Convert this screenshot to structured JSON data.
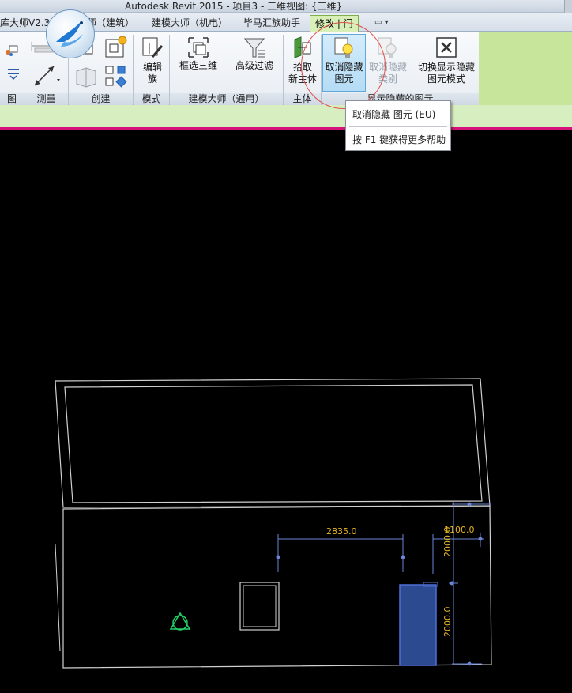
{
  "titlebar": {
    "title": "Autodesk Revit 2015 -    项目3 - 三维视图: {三维}"
  },
  "tabs": [
    {
      "label": "库大师V2.3"
    },
    {
      "label": "师（建筑）"
    },
    {
      "label": "建模大师（机电）"
    },
    {
      "label": "毕马汇族助手"
    },
    {
      "label": "修改 | 门"
    }
  ],
  "tab_dropdown": "▭ ▾",
  "ribbon": {
    "panels": {
      "view": "图",
      "measure": "测量",
      "create": "创建",
      "mode": "模式",
      "bim_general": "建模大师（通用）",
      "host": "主体",
      "show_hidden": "显示隐藏的图元"
    },
    "buttons": {
      "edit_family_line1": "编辑",
      "edit_family_line2": "族",
      "box_select_3d": "框选三维",
      "advanced_filter": "高级过滤",
      "pick_host_line1": "拾取",
      "pick_host_line2": "新主体",
      "unhide_element_line1": "取消隐藏",
      "unhide_element_line2": "图元",
      "unhide_category_line1": "取消隐藏",
      "unhide_category_line2": "类别",
      "toggle_reveal_line1": "切换显示隐藏",
      "toggle_reveal_line2": "图元模式"
    }
  },
  "tooltip": {
    "title": "取消隐藏 图元 (EU)",
    "help": "按 F1 键获得更多帮助"
  },
  "canvas": {
    "dimensions": {
      "width_left": "2835.0",
      "width_right": "1100.0",
      "height_upper": "2000.0",
      "height_lower": "2000.0"
    },
    "colors": {
      "background": "#000000",
      "lines": "#d0d0d0",
      "dimension": "#e6b422",
      "dimension_line": "#6a86d8",
      "door_fill": "#2b4a8f",
      "door_edge": "#4f6fd8",
      "marker": "#22d36a"
    }
  },
  "colors": {
    "active_tab": "#d8f0b8",
    "accent_highlight": "#e0504a",
    "divider": "#d4127a"
  }
}
